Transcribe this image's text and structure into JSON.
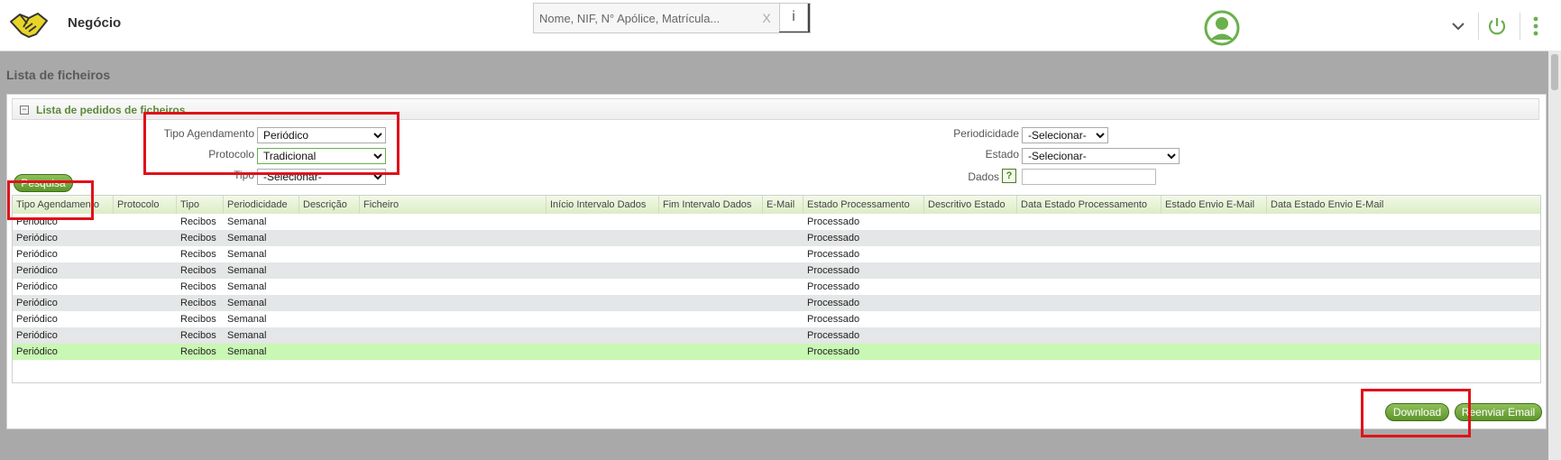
{
  "header": {
    "brand": "Negócio",
    "search_placeholder": "Nome, NIF, N° Apólice, Matrícula...",
    "search_clear": "X",
    "info_label": "i"
  },
  "page": {
    "title": "Lista de ficheiros"
  },
  "panel": {
    "title": "Lista de pedidos de ficheiros",
    "collapse_symbol": "−",
    "filters": {
      "tipo_agendamento": {
        "label": "Tipo Agendamento",
        "value": "Periódico"
      },
      "protocolo": {
        "label": "Protocolo",
        "value": "Tradicional"
      },
      "tipo": {
        "label": "Tipo",
        "value": "-Selecionar-"
      },
      "periodicidade": {
        "label": "Periodicidade",
        "value": "-Selecionar-"
      },
      "estado": {
        "label": "Estado",
        "value": "-Selecionar-"
      },
      "dados": {
        "label": "Dados",
        "help": "?"
      }
    },
    "search_button": "Pesquisa"
  },
  "table": {
    "columns": [
      "Tipo Agendamento",
      "Protocolo",
      "Tipo",
      "Periodicidade",
      "Descrição",
      "Ficheiro",
      "Início Intervalo Dados",
      "Fim Intervalo Dados",
      "E-Mail",
      "Estado Processamento",
      "Descritivo Estado",
      "Data Estado Processamento",
      "Estado Envio E-Mail",
      "Data Estado Envio E-Mail"
    ],
    "rows": [
      [
        "Periódico",
        "",
        "Recibos",
        "Semanal",
        "",
        "",
        "",
        "",
        "",
        "Processado",
        "",
        "",
        "",
        ""
      ],
      [
        "Periódico",
        "",
        "Recibos",
        "Semanal",
        "",
        "",
        "",
        "",
        "",
        "Processado",
        "",
        "",
        "",
        ""
      ],
      [
        "Periódico",
        "",
        "Recibos",
        "Semanal",
        "",
        "",
        "",
        "",
        "",
        "Processado",
        "",
        "",
        "",
        ""
      ],
      [
        "Periódico",
        "",
        "Recibos",
        "Semanal",
        "",
        "",
        "",
        "",
        "",
        "Processado",
        "",
        "",
        "",
        ""
      ],
      [
        "Periódico",
        "",
        "Recibos",
        "Semanal",
        "",
        "",
        "",
        "",
        "",
        "Processado",
        "",
        "",
        "",
        ""
      ],
      [
        "Periódico",
        "",
        "Recibos",
        "Semanal",
        "",
        "",
        "",
        "",
        "",
        "Processado",
        "",
        "",
        "",
        ""
      ],
      [
        "Periódico",
        "",
        "Recibos",
        "Semanal",
        "",
        "",
        "",
        "",
        "",
        "Processado",
        "",
        "",
        "",
        ""
      ],
      [
        "Periódico",
        "",
        "Recibos",
        "Semanal",
        "",
        "",
        "",
        "",
        "",
        "Processado",
        "",
        "",
        "",
        ""
      ],
      [
        "Periódico",
        "",
        "Recibos",
        "Semanal",
        "",
        "",
        "",
        "",
        "",
        "Processado",
        "",
        "",
        "",
        ""
      ]
    ],
    "selected_row": 8
  },
  "actions": {
    "download": "Download",
    "resend": "Reenviar Email"
  },
  "colors": {
    "accent_green": "#5e9529",
    "panel_title": "#5c8a3a",
    "highlight": "#e0121a",
    "selected_row": "#c9f7b4"
  }
}
